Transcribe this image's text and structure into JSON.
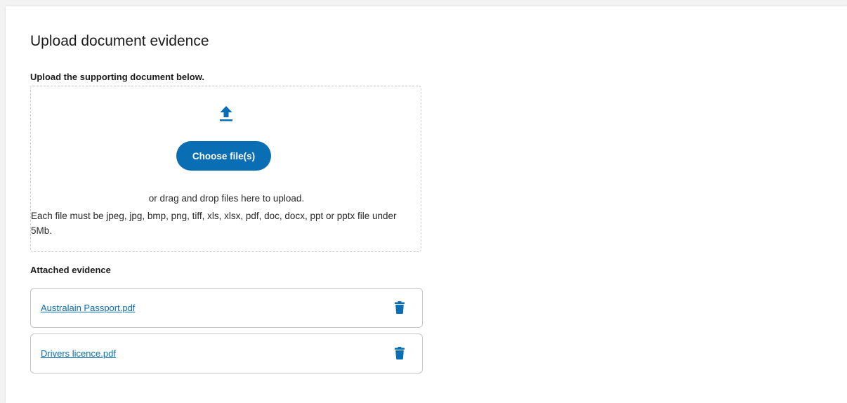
{
  "page": {
    "heading": "Upload document evidence",
    "instruction": "Upload the supporting document below."
  },
  "dropzone": {
    "upload_icon": "upload-arrow-icon",
    "choose_button_label": "Choose file(s)",
    "drag_text": "or drag and drop files here to upload.",
    "requirements": "Each file must be jpeg, jpg, bmp, png, tiff, xls, xlsx, pdf, doc, docx, ppt or pptx file under 5Mb."
  },
  "attached": {
    "label": "Attached evidence",
    "files": [
      {
        "name": "Australain Passport.pdf",
        "delete_icon": "trash-icon"
      },
      {
        "name": "Drivers licence.pdf",
        "delete_icon": "trash-icon"
      }
    ]
  },
  "colors": {
    "accent": "#0a6eb4",
    "background": "#ffffff",
    "border": "#c5c5c5"
  }
}
